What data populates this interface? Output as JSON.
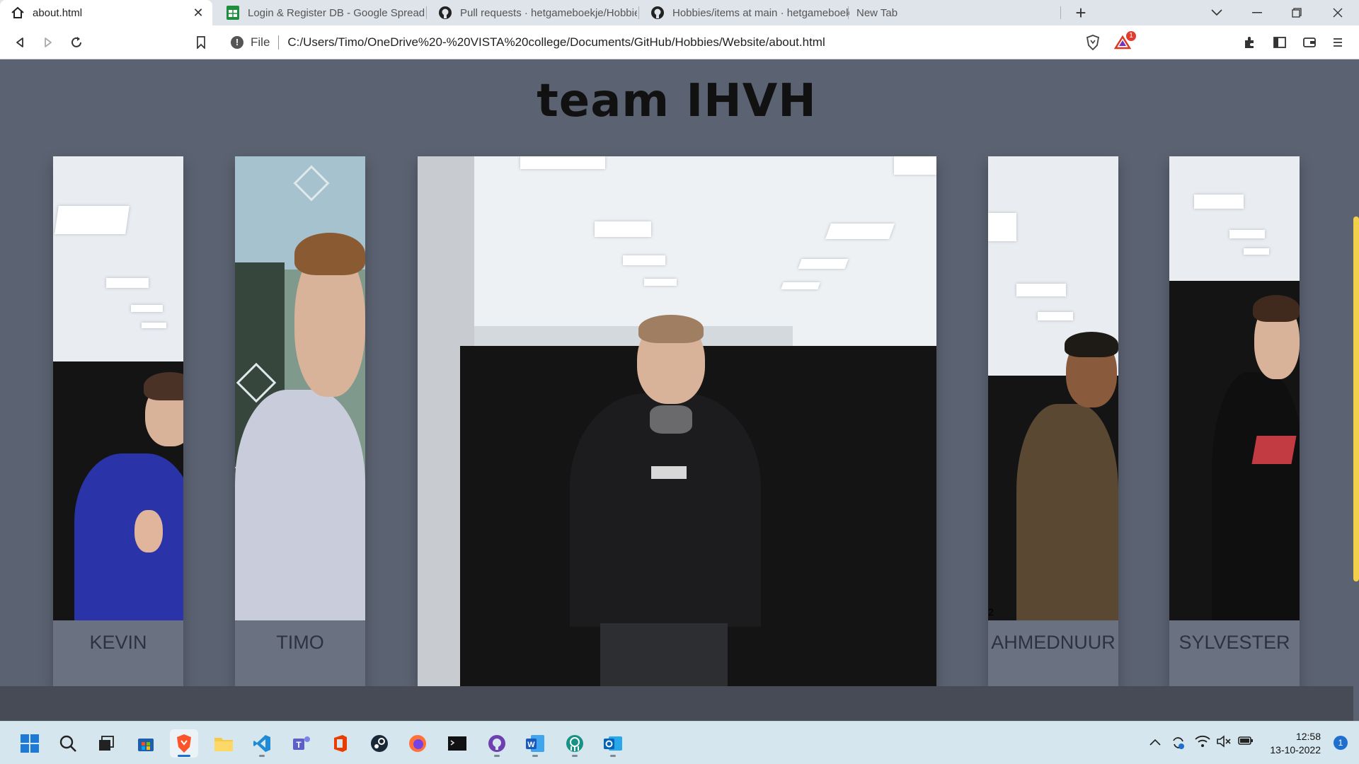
{
  "browser": {
    "tabs": [
      {
        "title": "about.html",
        "icon": "home-icon",
        "active": true
      },
      {
        "title": "Login & Register DB - Google Spreads",
        "icon": "sheets-icon",
        "active": false
      },
      {
        "title": "Pull requests · hetgameboekje/Hobbie",
        "icon": "github-icon",
        "active": false
      },
      {
        "title": "Hobbies/items at main · hetgameboek",
        "icon": "github-icon",
        "active": false
      },
      {
        "title": "New Tab",
        "icon": "",
        "active": false
      }
    ],
    "address": {
      "scheme_label": "File",
      "url": "C:/Users/Timo/OneDrive%20-%20VISTA%20college/Documents/GitHub/Hobbies/Website/about.html"
    },
    "rewards_badge": "1"
  },
  "page": {
    "title": "team IHVH",
    "members": [
      {
        "name": "KEVIN"
      },
      {
        "name": "TIMO"
      },
      {
        "name": ""
      },
      {
        "name": "AHMEDNUUR",
        "stray_text": "2"
      },
      {
        "name": "SYLVESTER"
      }
    ]
  },
  "taskbar": {
    "apps": [
      "start-icon",
      "search-icon",
      "task-view-icon",
      "store-icon",
      "brave-icon",
      "file-explorer-icon",
      "vscode-icon",
      "teams-icon",
      "office-icon",
      "steam-icon",
      "firefox-icon",
      "terminal-icon",
      "github-desktop-icon",
      "word-icon",
      "gitkraken-icon",
      "outlook-icon"
    ],
    "time": "12:58",
    "date": "13-10-2022",
    "notification_count": "1"
  },
  "colors": {
    "page_bg": "#5b6271",
    "card_bg": "#6a7181",
    "accent_scroll": "#f2d04a",
    "footer_band": "#474b55"
  }
}
